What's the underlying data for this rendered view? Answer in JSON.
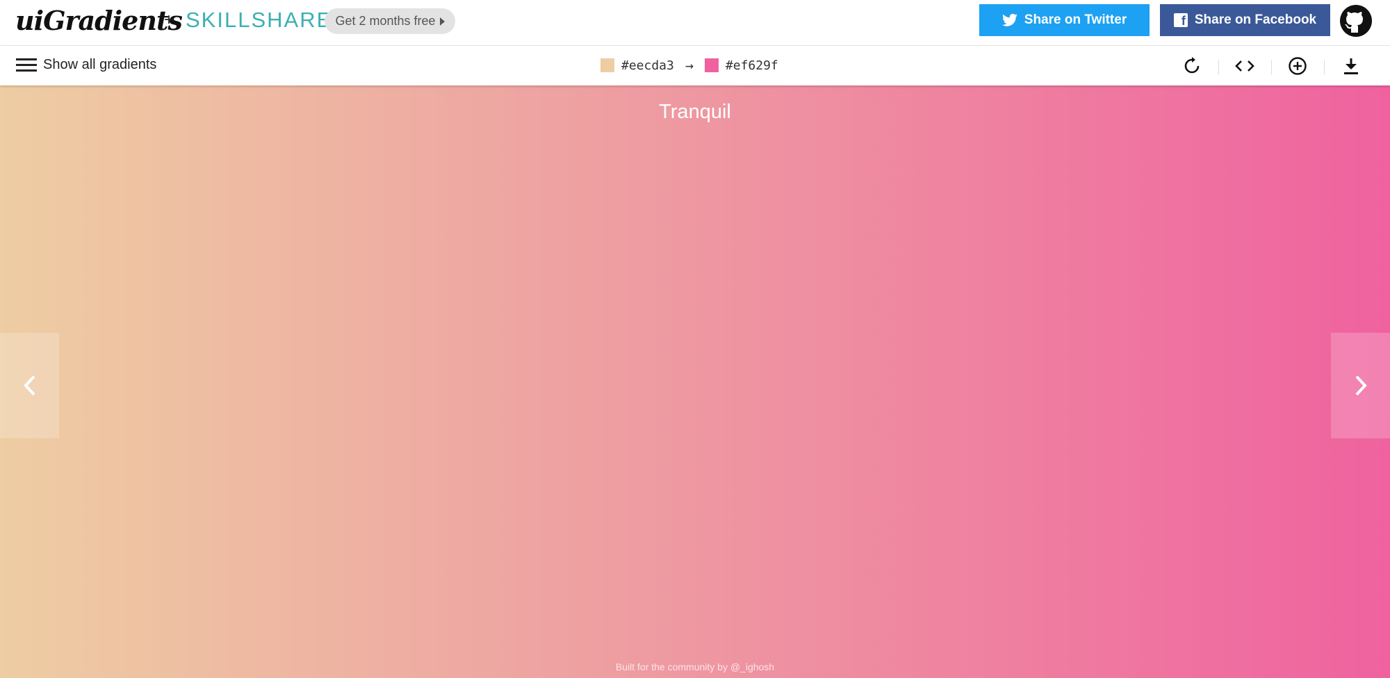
{
  "header": {
    "logo": "uiGradients",
    "plus": "+",
    "partner": "SKILLSHARE",
    "promo_label": "Get 2 months free",
    "twitter_label": "Share on Twitter",
    "facebook_label": "Share on Facebook",
    "twitter_color": "#1da1f2",
    "facebook_color": "#3b5998"
  },
  "toolbar": {
    "menu_label": "Show all gradients",
    "color_start": "#eecda3",
    "color_arrow": "→",
    "color_end": "#ef629f",
    "tools": [
      "rotate-icon",
      "code-icon",
      "add-icon",
      "download-icon"
    ]
  },
  "gradient": {
    "name": "Tranquil",
    "from": "#eecda3",
    "to": "#ef629f",
    "direction": "to right"
  },
  "footer": {
    "text": "Built for the community by @_ighosh"
  }
}
